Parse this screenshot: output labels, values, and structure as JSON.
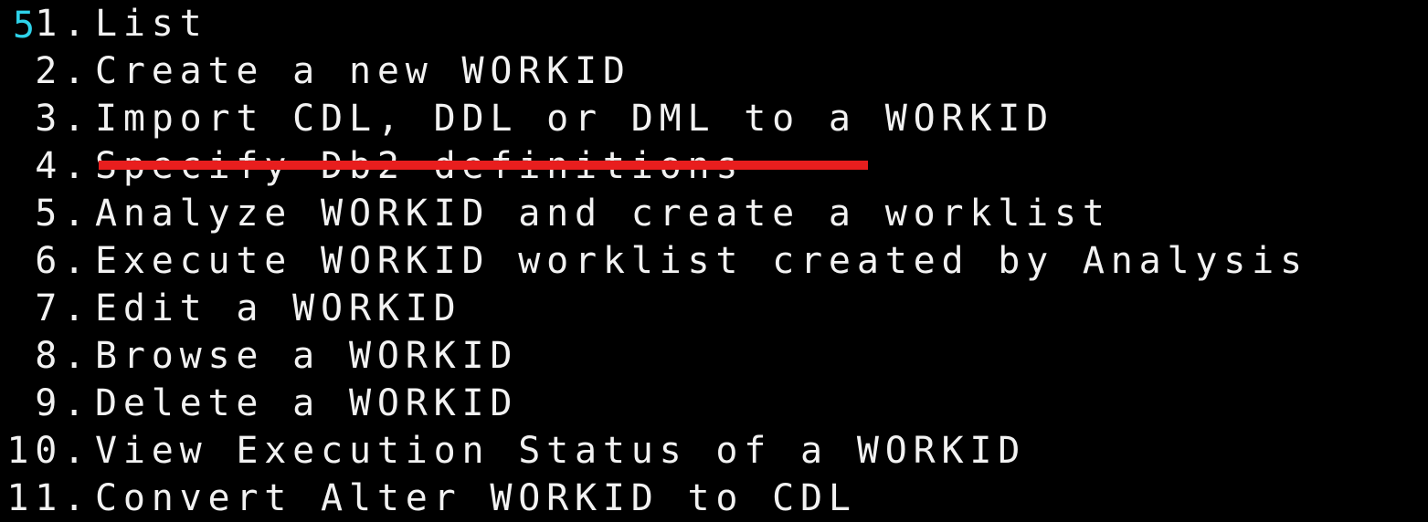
{
  "selection": {
    "value": "5"
  },
  "menu": {
    "items": [
      {
        "number": "1.",
        "label": "List"
      },
      {
        "number": "2.",
        "label": "Create a new WORKID"
      },
      {
        "number": "3.",
        "label": "Import CDL, DDL or DML to a WORKID"
      },
      {
        "number": "4.",
        "label": "Specify Db2 definitions",
        "struck_out": true
      },
      {
        "number": "5.",
        "label": "Analyze WORKID and create a worklist"
      },
      {
        "number": "6.",
        "label": "Execute WORKID worklist created by Analysis"
      },
      {
        "number": "7.",
        "label": "Edit a WORKID"
      },
      {
        "number": "8.",
        "label": "Browse a WORKID"
      },
      {
        "number": "9.",
        "label": "Delete a WORKID"
      },
      {
        "number": "10.",
        "label": "View Execution Status of a WORKID"
      },
      {
        "number": "11.",
        "label": "Convert Alter WORKID to CDL"
      }
    ]
  },
  "colors": {
    "background": "#000000",
    "text": "#f2f2f2",
    "selection_text": "#2ed3ea",
    "strike_annotation": "#e81e1e"
  }
}
